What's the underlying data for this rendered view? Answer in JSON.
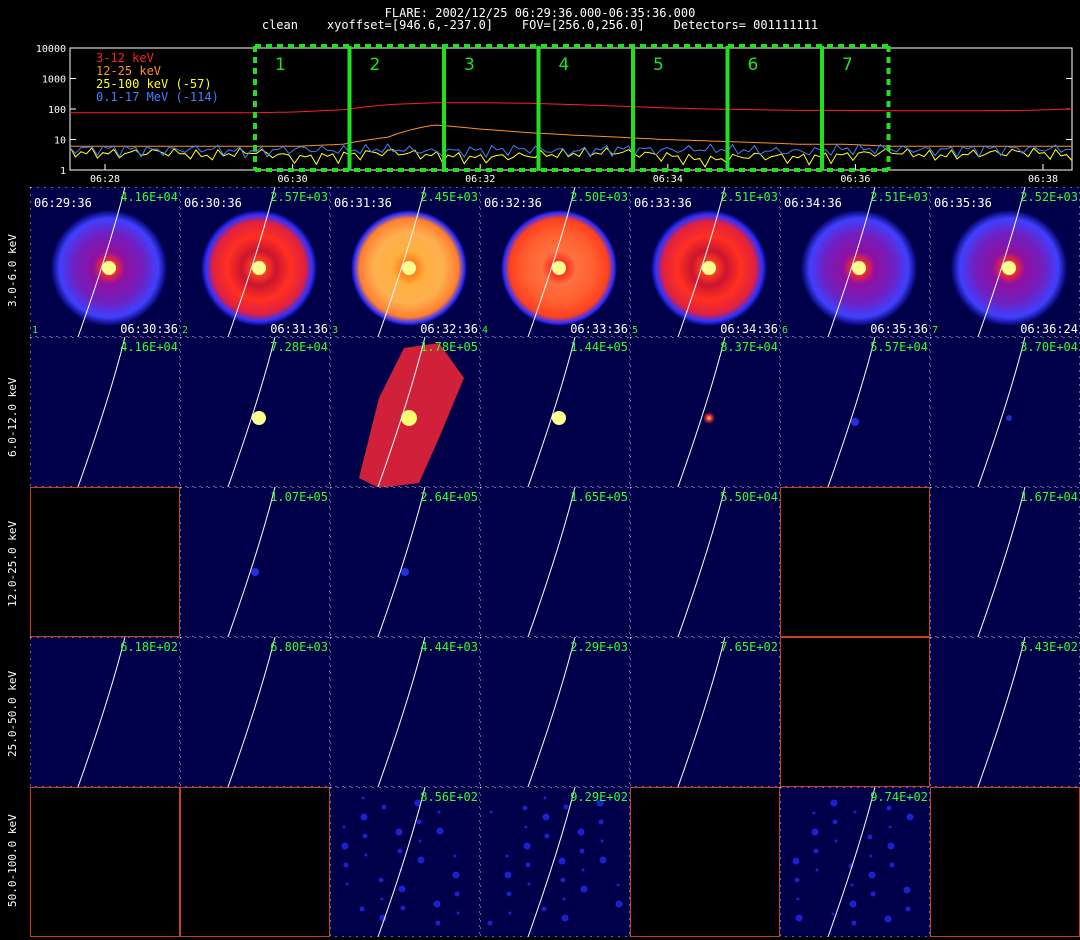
{
  "header": {
    "line1": "FLARE: 2002/12/25 06:29:36.000-06:35:36.000",
    "line2": "clean    xyoffset=[946.6,-237.0]    FOV=[256.0,256.0]    Detectors= 001111111"
  },
  "chart_data": [
    {
      "type": "line",
      "y_scale": "log",
      "ylim": [
        1,
        10000
      ],
      "y_ticks": [
        "10000",
        "1000",
        "100",
        "10",
        "1"
      ],
      "x_ticks": [
        "06:28",
        "06:30",
        "06:32",
        "06:34",
        "06:36",
        "06:38"
      ],
      "series": [
        {
          "name": "3-12 keV",
          "color": "#ff2020",
          "values": [
            75,
            75,
            75,
            75,
            75,
            80,
            95,
            140,
            160,
            160,
            155,
            140,
            125,
            110,
            100,
            95,
            90,
            90,
            88,
            87,
            88,
            90,
            100
          ]
        },
        {
          "name": "12-25 keV",
          "color": "#ff9020",
          "values": [
            6,
            6,
            6,
            6,
            6,
            6,
            7,
            12,
            30,
            22,
            17,
            14,
            12,
            10,
            9,
            8,
            7,
            7,
            6,
            6,
            6,
            6,
            6
          ]
        },
        {
          "name": "25-100 keV (-57)",
          "color": "#ffff20",
          "values": [
            4,
            3.5,
            4,
            3,
            4,
            2.5,
            3,
            4,
            3,
            2.5,
            3,
            3.5,
            4,
            3,
            2,
            3,
            2.5,
            3,
            4,
            3,
            3.5,
            4,
            3
          ]
        },
        {
          "name": "0.1-17 MeV (-114)",
          "color": "#4080ff",
          "values": [
            5,
            5,
            4.5,
            5,
            4,
            5,
            4.5,
            5,
            4,
            4.5,
            5,
            4,
            5,
            4.5,
            5,
            4.5,
            4,
            5,
            5,
            4.5,
            5,
            5,
            5
          ]
        }
      ],
      "intervals": [
        "1",
        "2",
        "3",
        "4",
        "5",
        "6",
        "7"
      ],
      "interval_color": "#20e020"
    },
    {
      "type": "heatmap",
      "row_labels": [
        "3.0-6.0 keV",
        "6.0-12.0 keV",
        "12.0-25.0 keV",
        "25.0-50.0 keV",
        "50.0-100.0 keV"
      ],
      "columns": [
        {
          "index": "1",
          "start": "06:29:36",
          "end": "06:30:36"
        },
        {
          "index": "2",
          "start": "06:30:36",
          "end": "06:31:36"
        },
        {
          "index": "3",
          "start": "06:31:36",
          "end": "06:32:36"
        },
        {
          "index": "4",
          "start": "06:32:36",
          "end": "06:33:36"
        },
        {
          "index": "5",
          "start": "06:33:36",
          "end": "06:34:36"
        },
        {
          "index": "6",
          "start": "06:34:36",
          "end": "06:35:36"
        },
        {
          "index": "7",
          "start": "06:35:36",
          "end": "06:36:24"
        }
      ],
      "max_values": [
        [
          "4.16E+04",
          "2.57E+03",
          "2.45E+03",
          "2.50E+03",
          "2.51E+03",
          "2.51E+03",
          "2.52E+03"
        ],
        [
          "4.16E+04",
          "7.28E+04",
          "1.78E+05",
          "1.44E+05",
          "8.37E+04",
          "5.57E+04",
          "3.70E+04"
        ],
        [
          "",
          "1.07E+05",
          "2.64E+05",
          "1.65E+05",
          "5.50E+04",
          "",
          "1.67E+04"
        ],
        [
          "6.18E+02",
          "6.80E+03",
          "4.44E+03",
          "2.29E+03",
          "7.65E+02",
          "",
          "5.43E+02"
        ],
        [
          "",
          "",
          "8.56E+02",
          "9.29E+02",
          "",
          "9.74E+02",
          ""
        ]
      ],
      "panel_kind": [
        [
          "ring1",
          "ring2",
          "ring3",
          "ring4",
          "ring5",
          "ring6",
          "ring7"
        ],
        [
          "faint",
          "ring-blue-small",
          "blob-red",
          "ring-blue",
          "dot",
          "dot-small",
          "dot-tiny"
        ],
        [
          "empty",
          "dot-small",
          "dot-small",
          "plain",
          "plain",
          "empty",
          "plain"
        ],
        [
          "plain",
          "plain",
          "plain",
          "plain",
          "plain",
          "empty",
          "plain"
        ],
        [
          "empty",
          "empty",
          "noise",
          "noise",
          "empty",
          "noise",
          "empty"
        ]
      ]
    }
  ]
}
